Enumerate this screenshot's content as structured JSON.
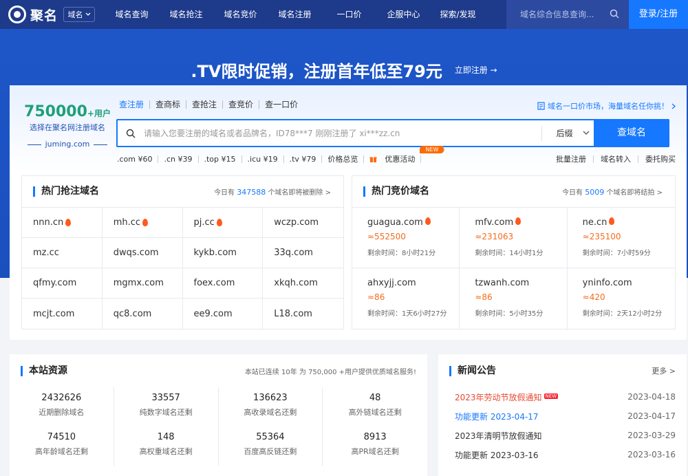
{
  "nav": {
    "logo": "聚名",
    "select": "域名",
    "menu": [
      "域名查询",
      "域名抢注",
      "域名竞价",
      "域名注册",
      "一口价",
      "企服中心",
      "探索/发现"
    ],
    "search_placeholder": "域名综合信息查询...",
    "login": "登录/注册"
  },
  "banner": {
    "title": ".TV限时促销，注册首年低至79元",
    "cta": "立即注册 →"
  },
  "promo": {
    "number": "750000",
    "suffix": "+用户",
    "subtitle": "选择在聚名网注册域名",
    "site": "juming.com"
  },
  "search": {
    "tabs": [
      "查注册",
      "查商标",
      "查抢注",
      "查竞价",
      "查一口价"
    ],
    "active_tab": 0,
    "market_link": "域名一口价市场，海量域名任你挑！",
    "placeholder": "请输入您要注册的域名或者品牌名，ID78***7 刚刚注册了 xi***zz.cn",
    "suffix_label": "后缀",
    "button": "查域名",
    "prices": [
      ".com ¥60",
      ".cn ¥39",
      ".top ¥15",
      ".icu ¥19",
      ".tv ¥79",
      "价格总览"
    ],
    "event": "优惠活动",
    "event_badge": "NEW",
    "right_links": [
      "批量注册",
      "域名转入",
      "委托购买"
    ]
  },
  "hot_snipe": {
    "title": "热门抢注域名",
    "info_prefix": "今日有",
    "info_count": "347588",
    "info_suffix": "个域名即将被删除 >",
    "domains": [
      {
        "name": "nnn.cn",
        "hot": true
      },
      {
        "name": "mh.cc",
        "hot": true
      },
      {
        "name": "pj.cc",
        "hot": true
      },
      {
        "name": "wczp.com",
        "hot": false
      },
      {
        "name": "mz.cc",
        "hot": false
      },
      {
        "name": "dwqs.com",
        "hot": false
      },
      {
        "name": "kykb.com",
        "hot": false
      },
      {
        "name": "33q.com",
        "hot": false
      },
      {
        "name": "qfmy.com",
        "hot": false
      },
      {
        "name": "mgmx.com",
        "hot": false
      },
      {
        "name": "foex.com",
        "hot": false
      },
      {
        "name": "xkqh.com",
        "hot": false
      },
      {
        "name": "mcjt.com",
        "hot": false
      },
      {
        "name": "qc8.com",
        "hot": false
      },
      {
        "name": "ee9.com",
        "hot": false
      },
      {
        "name": "L18.com",
        "hot": false
      }
    ]
  },
  "hot_auction": {
    "title": "热门竞价域名",
    "info_prefix": "今日有",
    "info_count": "5009",
    "info_suffix": "个域名即将结拍 >",
    "items": [
      {
        "name": "guagua.com",
        "hot": true,
        "price": "≈552500",
        "remain": "剩余时间：8小时21分"
      },
      {
        "name": "mfv.com",
        "hot": true,
        "price": "≈231063",
        "remain": "剩余时间：14小时1分"
      },
      {
        "name": "ne.cn",
        "hot": true,
        "price": "≈235100",
        "remain": "剩余时间：7小时59分"
      },
      {
        "name": "ahxyjj.com",
        "hot": false,
        "price": "≈86",
        "remain": "剩余时间：1天6小时27分"
      },
      {
        "name": "tzwanh.com",
        "hot": false,
        "price": "≈86",
        "remain": "剩余时间：5小时35分"
      },
      {
        "name": "yninfo.com",
        "hot": false,
        "price": "≈420",
        "remain": "剩余时间：2天12小时2分"
      }
    ]
  },
  "resources": {
    "title": "本站资源",
    "info": "本站已连续 10年 为 750,000 +用户提供优质域名服务!",
    "stats": [
      {
        "value": "2432626",
        "label": "近期删除域名"
      },
      {
        "value": "33557",
        "label": "纯数字域名还剩"
      },
      {
        "value": "136623",
        "label": "高收录域名还剩"
      },
      {
        "value": "48",
        "label": "高外链域名还剩"
      },
      {
        "value": "74510",
        "label": "高年龄域名还剩"
      },
      {
        "value": "148",
        "label": "高权重域名还剩"
      },
      {
        "value": "55364",
        "label": "百度高反链还剩"
      },
      {
        "value": "8913",
        "label": "高PR域名还剩"
      }
    ]
  },
  "news": {
    "title": "新闻公告",
    "more": "更多 >",
    "new_badge": "NEW",
    "items": [
      {
        "title": "2023年劳动节放假通知",
        "date": "2023-04-18",
        "style": "red",
        "new": true
      },
      {
        "title": "功能更新 2023-04-17",
        "date": "2023-04-17",
        "style": "blue",
        "new": false
      },
      {
        "title": "2023年清明节放假通知",
        "date": "2023-03-29",
        "style": "",
        "new": false
      },
      {
        "title": "功能更新 2023-03-16",
        "date": "2023-03-16",
        "style": "",
        "new": false
      }
    ]
  }
}
